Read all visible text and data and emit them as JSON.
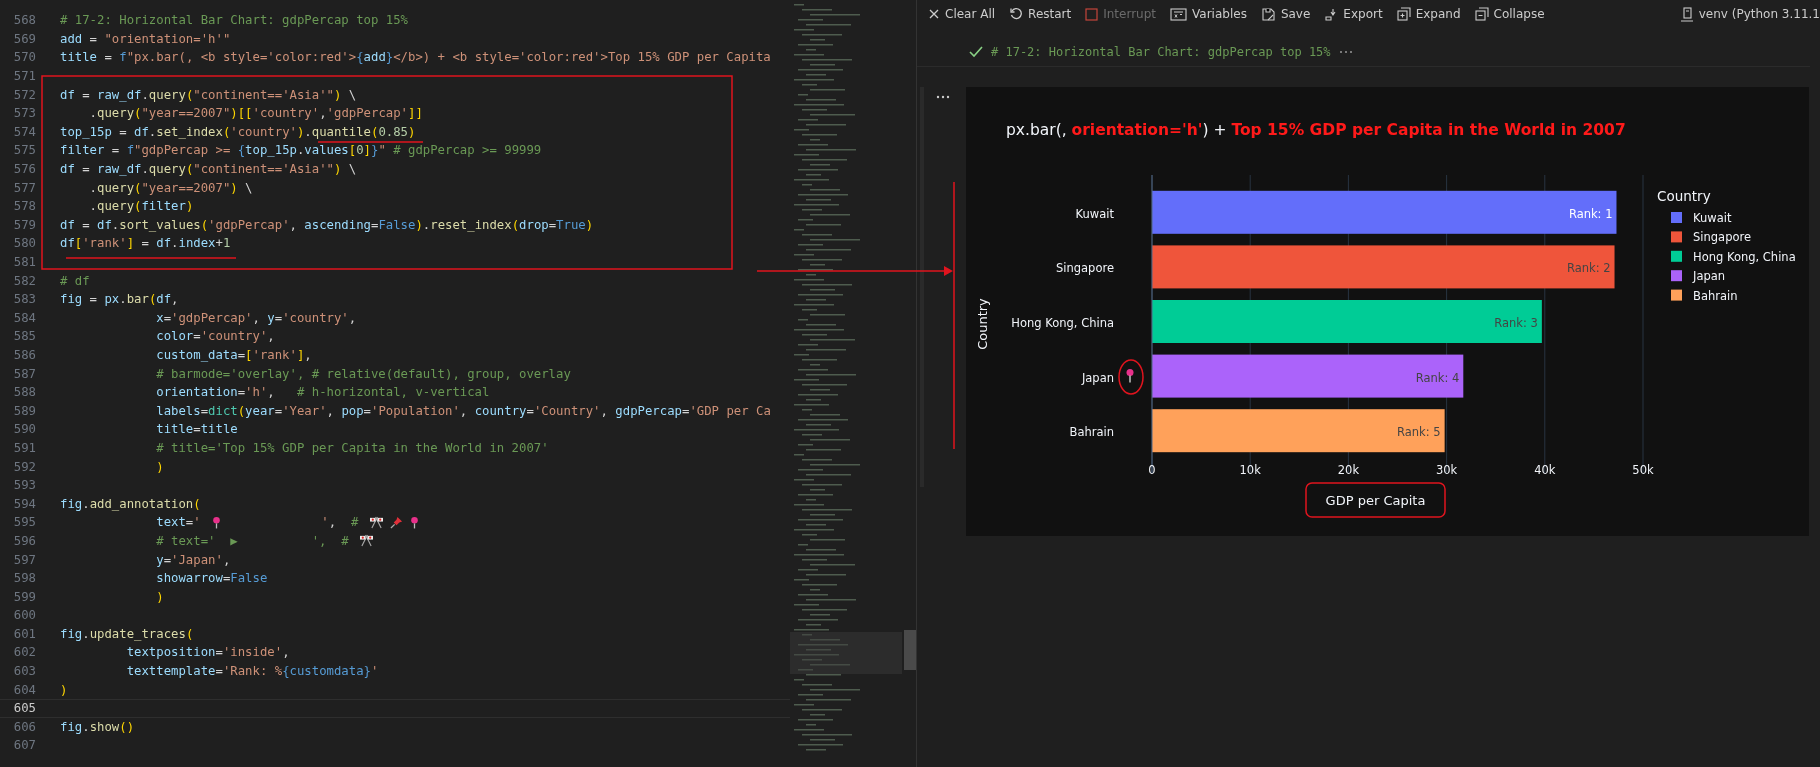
{
  "editor": {
    "lines": [
      {
        "number": "568",
        "current": false,
        "tokens": [
          {
            "kind": "comment",
            "text": "# 17-2: Horizontal Bar Chart: gdpPercap top 15%"
          }
        ]
      },
      {
        "number": "569",
        "current": false,
        "tokens": [
          {
            "kind": "variable",
            "text": "add"
          },
          {
            "kind": "plain",
            "text": " = "
          },
          {
            "kind": "string",
            "text": "\"orientation='h'\""
          }
        ]
      },
      {
        "number": "570",
        "current": false,
        "tokens": [
          {
            "kind": "variable",
            "text": "title"
          },
          {
            "kind": "plain",
            "text": " = "
          },
          {
            "kind": "keyword",
            "text": "f"
          },
          {
            "kind": "string",
            "text": "\"px.bar(, <b style='color:red'>"
          },
          {
            "kind": "keyword",
            "text": "{"
          },
          {
            "kind": "variable",
            "text": "add"
          },
          {
            "kind": "keyword",
            "text": "}"
          },
          {
            "kind": "string",
            "text": "</b>) + <b style='color:red'>Top 15% GDP per Capita"
          }
        ]
      },
      {
        "number": "571",
        "current": false
      },
      {
        "number": "572",
        "current": false,
        "tokens": [
          {
            "kind": "variable",
            "text": "df"
          },
          {
            "kind": "plain",
            "text": " = "
          },
          {
            "kind": "variable",
            "text": "raw_df"
          },
          {
            "kind": "plain",
            "text": "."
          },
          {
            "kind": "function",
            "text": "query"
          },
          {
            "kind": "bracket",
            "text": "("
          },
          {
            "kind": "string",
            "text": "\"continent=='Asia'\""
          },
          {
            "kind": "bracket",
            "text": ")"
          },
          {
            "kind": "plain",
            "text": " \\"
          }
        ]
      },
      {
        "number": "573",
        "current": false,
        "tokens": [
          {
            "kind": "plain",
            "text": "    ."
          },
          {
            "kind": "function",
            "text": "query"
          },
          {
            "kind": "bracket",
            "text": "("
          },
          {
            "kind": "string",
            "text": "\"year==2007\""
          },
          {
            "kind": "bracket",
            "text": ")"
          },
          {
            "kind": "bracket",
            "text": "[["
          },
          {
            "kind": "string",
            "text": "'country'"
          },
          {
            "kind": "plain",
            "text": ","
          },
          {
            "kind": "string",
            "text": "'gdpPercap'"
          },
          {
            "kind": "bracket",
            "text": "]]"
          }
        ]
      },
      {
        "number": "574",
        "current": false,
        "tokens": [
          {
            "kind": "variable",
            "text": "top_15p"
          },
          {
            "kind": "plain",
            "text": " = "
          },
          {
            "kind": "variable",
            "text": "df"
          },
          {
            "kind": "plain",
            "text": "."
          },
          {
            "kind": "function",
            "text": "set_index"
          },
          {
            "kind": "bracket",
            "text": "("
          },
          {
            "kind": "string",
            "text": "'country'"
          },
          {
            "kind": "bracket",
            "text": ")"
          },
          {
            "kind": "plain",
            "text": "."
          },
          {
            "kind": "function",
            "text": "quantile"
          },
          {
            "kind": "bracket",
            "text": "("
          },
          {
            "kind": "number",
            "text": "0.85"
          },
          {
            "kind": "bracket",
            "text": ")"
          }
        ]
      },
      {
        "number": "575",
        "current": false,
        "tokens": [
          {
            "kind": "variable",
            "text": "filter"
          },
          {
            "kind": "plain",
            "text": " = "
          },
          {
            "kind": "keyword",
            "text": "f"
          },
          {
            "kind": "string",
            "text": "\"gdpPercap >= "
          },
          {
            "kind": "keyword",
            "text": "{"
          },
          {
            "kind": "variable",
            "text": "top_15p"
          },
          {
            "kind": "plain",
            "text": "."
          },
          {
            "kind": "variable",
            "text": "values"
          },
          {
            "kind": "bracket",
            "text": "["
          },
          {
            "kind": "number",
            "text": "0"
          },
          {
            "kind": "bracket",
            "text": "]"
          },
          {
            "kind": "keyword",
            "text": "}"
          },
          {
            "kind": "string",
            "text": "\""
          },
          {
            "kind": "comment",
            "text": " # gdpPercap >= 99999"
          }
        ]
      },
      {
        "number": "576",
        "current": false,
        "tokens": [
          {
            "kind": "variable",
            "text": "df"
          },
          {
            "kind": "plain",
            "text": " = "
          },
          {
            "kind": "variable",
            "text": "raw_df"
          },
          {
            "kind": "plain",
            "text": "."
          },
          {
            "kind": "function",
            "text": "query"
          },
          {
            "kind": "bracket",
            "text": "("
          },
          {
            "kind": "string",
            "text": "\"continent=='Asia'\""
          },
          {
            "kind": "bracket",
            "text": ")"
          },
          {
            "kind": "plain",
            "text": " \\"
          }
        ]
      },
      {
        "number": "577",
        "current": false,
        "tokens": [
          {
            "kind": "plain",
            "text": "    ."
          },
          {
            "kind": "function",
            "text": "query"
          },
          {
            "kind": "bracket",
            "text": "("
          },
          {
            "kind": "string",
            "text": "\"year==2007\""
          },
          {
            "kind": "bracket",
            "text": ")"
          },
          {
            "kind": "plain",
            "text": " \\"
          }
        ]
      },
      {
        "number": "578",
        "current": false,
        "tokens": [
          {
            "kind": "plain",
            "text": "    ."
          },
          {
            "kind": "function",
            "text": "query"
          },
          {
            "kind": "bracket",
            "text": "("
          },
          {
            "kind": "variable",
            "text": "filter"
          },
          {
            "kind": "bracket",
            "text": ")"
          }
        ]
      },
      {
        "number": "579",
        "current": false,
        "tokens": [
          {
            "kind": "variable",
            "text": "df"
          },
          {
            "kind": "plain",
            "text": " = "
          },
          {
            "kind": "variable",
            "text": "df"
          },
          {
            "kind": "plain",
            "text": "."
          },
          {
            "kind": "function",
            "text": "sort_values"
          },
          {
            "kind": "bracket",
            "text": "("
          },
          {
            "kind": "string",
            "text": "'gdpPercap'"
          },
          {
            "kind": "plain",
            "text": ", "
          },
          {
            "kind": "variable",
            "text": "ascending"
          },
          {
            "kind": "plain",
            "text": "="
          },
          {
            "kind": "keyword",
            "text": "False"
          },
          {
            "kind": "bracket",
            "text": ")"
          },
          {
            "kind": "plain",
            "text": "."
          },
          {
            "kind": "function",
            "text": "reset_index"
          },
          {
            "kind": "bracket",
            "text": "("
          },
          {
            "kind": "variable",
            "text": "drop"
          },
          {
            "kind": "plain",
            "text": "="
          },
          {
            "kind": "keyword",
            "text": "True"
          },
          {
            "kind": "bracket",
            "text": ")"
          }
        ]
      },
      {
        "number": "580",
        "current": false,
        "tokens": [
          {
            "kind": "variable",
            "text": "df"
          },
          {
            "kind": "bracket",
            "text": "["
          },
          {
            "kind": "string",
            "text": "'rank'"
          },
          {
            "kind": "bracket",
            "text": "]"
          },
          {
            "kind": "plain",
            "text": " = "
          },
          {
            "kind": "variable",
            "text": "df"
          },
          {
            "kind": "plain",
            "text": "."
          },
          {
            "kind": "variable",
            "text": "index"
          },
          {
            "kind": "plain",
            "text": "+"
          },
          {
            "kind": "number",
            "text": "1"
          }
        ]
      },
      {
        "number": "581",
        "current": false
      },
      {
        "number": "582",
        "current": false,
        "tokens": [
          {
            "kind": "comment",
            "text": "# df"
          }
        ]
      },
      {
        "number": "583",
        "current": false,
        "tokens": [
          {
            "kind": "variable",
            "text": "fig"
          },
          {
            "kind": "plain",
            "text": " = "
          },
          {
            "kind": "variable",
            "text": "px"
          },
          {
            "kind": "plain",
            "text": "."
          },
          {
            "kind": "function",
            "text": "bar"
          },
          {
            "kind": "bracket",
            "text": "("
          },
          {
            "kind": "variable",
            "text": "df"
          },
          {
            "kind": "plain",
            "text": ","
          }
        ]
      },
      {
        "number": "584",
        "current": false,
        "tokens": [
          {
            "kind": "variable",
            "text": "             x"
          },
          {
            "kind": "plain",
            "text": "="
          },
          {
            "kind": "string",
            "text": "'gdpPercap'"
          },
          {
            "kind": "plain",
            "text": ", "
          },
          {
            "kind": "variable",
            "text": "y"
          },
          {
            "kind": "plain",
            "text": "="
          },
          {
            "kind": "string",
            "text": "'country'"
          },
          {
            "kind": "plain",
            "text": ","
          }
        ]
      },
      {
        "number": "585",
        "current": false,
        "tokens": [
          {
            "kind": "variable",
            "text": "             color"
          },
          {
            "kind": "plain",
            "text": "="
          },
          {
            "kind": "string",
            "text": "'country'"
          },
          {
            "kind": "plain",
            "text": ","
          }
        ]
      },
      {
        "number": "586",
        "current": false,
        "tokens": [
          {
            "kind": "variable",
            "text": "             custom_data"
          },
          {
            "kind": "plain",
            "text": "="
          },
          {
            "kind": "bracket",
            "text": "["
          },
          {
            "kind": "string",
            "text": "'rank'"
          },
          {
            "kind": "bracket",
            "text": "]"
          },
          {
            "kind": "plain",
            "text": ","
          }
        ]
      },
      {
        "number": "587",
        "current": false,
        "tokens": [
          {
            "kind": "comment",
            "text": "             # barmode='overlay', # relative(default), group, overlay"
          }
        ]
      },
      {
        "number": "588",
        "current": false,
        "tokens": [
          {
            "kind": "variable",
            "text": "             orientation"
          },
          {
            "kind": "plain",
            "text": "="
          },
          {
            "kind": "string",
            "text": "'h'"
          },
          {
            "kind": "plain",
            "text": ","
          },
          {
            "kind": "comment",
            "text": "   # h-horizontal, v-vertical"
          }
        ]
      },
      {
        "number": "589",
        "current": false,
        "tokens": [
          {
            "kind": "variable",
            "text": "             labels"
          },
          {
            "kind": "plain",
            "text": "="
          },
          {
            "kind": "class",
            "text": "dict"
          },
          {
            "kind": "bracket",
            "text": "("
          },
          {
            "kind": "variable",
            "text": "year"
          },
          {
            "kind": "plain",
            "text": "="
          },
          {
            "kind": "string",
            "text": "'Year'"
          },
          {
            "kind": "plain",
            "text": ", "
          },
          {
            "kind": "variable",
            "text": "pop"
          },
          {
            "kind": "plain",
            "text": "="
          },
          {
            "kind": "string",
            "text": "'Population'"
          },
          {
            "kind": "plain",
            "text": ", "
          },
          {
            "kind": "variable",
            "text": "country"
          },
          {
            "kind": "plain",
            "text": "="
          },
          {
            "kind": "string",
            "text": "'Country'"
          },
          {
            "kind": "plain",
            "text": ", "
          },
          {
            "kind": "variable",
            "text": "gdpPercap"
          },
          {
            "kind": "plain",
            "text": "="
          },
          {
            "kind": "string",
            "text": "'GDP per Ca"
          }
        ]
      },
      {
        "number": "590",
        "current": false,
        "tokens": [
          {
            "kind": "variable",
            "text": "             title"
          },
          {
            "kind": "plain",
            "text": "="
          },
          {
            "kind": "variable",
            "text": "title"
          }
        ]
      },
      {
        "number": "591",
        "current": false,
        "tokens": [
          {
            "kind": "comment",
            "text": "             # title='Top 15% GDP per Capita in the World in 2007'"
          }
        ]
      },
      {
        "number": "592",
        "current": false,
        "tokens": [
          {
            "kind": "bracket",
            "text": "             )"
          }
        ]
      },
      {
        "number": "593",
        "current": false
      },
      {
        "number": "594",
        "current": false,
        "tokens": [
          {
            "kind": "variable",
            "text": "fig"
          },
          {
            "kind": "plain",
            "text": "."
          },
          {
            "kind": "function",
            "text": "add_annotation"
          },
          {
            "kind": "bracket",
            "text": "("
          }
        ]
      },
      {
        "number": "595",
        "current": false,
        "tokens": [
          {
            "kind": "variable",
            "text": "             text"
          },
          {
            "kind": "plain",
            "text": "="
          },
          {
            "kind": "string",
            "text": "' "
          },
          {
            "kind": "pin"
          },
          {
            "kind": "string",
            "text": "             '"
          },
          {
            "kind": "plain",
            "text": ",  "
          },
          {
            "kind": "comment",
            "text": "# "
          },
          {
            "kind": "flags"
          },
          {
            "kind": "pushpin"
          },
          {
            "kind": "pin"
          }
        ]
      },
      {
        "number": "596",
        "current": false,
        "tokens": [
          {
            "kind": "comment",
            "text": "             # text='  ▶          ',  # "
          },
          {
            "kind": "flags"
          }
        ]
      },
      {
        "number": "597",
        "current": false,
        "tokens": [
          {
            "kind": "variable",
            "text": "             y"
          },
          {
            "kind": "plain",
            "text": "="
          },
          {
            "kind": "string",
            "text": "'Japan'"
          },
          {
            "kind": "plain",
            "text": ","
          }
        ]
      },
      {
        "number": "598",
        "current": false,
        "tokens": [
          {
            "kind": "variable",
            "text": "             showarrow"
          },
          {
            "kind": "plain",
            "text": "="
          },
          {
            "kind": "keyword",
            "text": "False"
          }
        ]
      },
      {
        "number": "599",
        "current": false,
        "tokens": [
          {
            "kind": "bracket",
            "text": "             )"
          }
        ]
      },
      {
        "number": "600",
        "current": false
      },
      {
        "number": "601",
        "current": false,
        "tokens": [
          {
            "kind": "variable",
            "text": "fig"
          },
          {
            "kind": "plain",
            "text": "."
          },
          {
            "kind": "function",
            "text": "update_traces"
          },
          {
            "kind": "bracket",
            "text": "("
          }
        ]
      },
      {
        "number": "602",
        "current": false,
        "tokens": [
          {
            "kind": "variable",
            "text": "         textposition"
          },
          {
            "kind": "plain",
            "text": "="
          },
          {
            "kind": "string",
            "text": "'inside'"
          },
          {
            "kind": "plain",
            "text": ","
          }
        ]
      },
      {
        "number": "603",
        "current": false,
        "tokens": [
          {
            "kind": "variable",
            "text": "         texttemplate"
          },
          {
            "kind": "plain",
            "text": "="
          },
          {
            "kind": "string",
            "text": "'Rank: %"
          },
          {
            "kind": "keyword",
            "text": "{customdata}"
          },
          {
            "kind": "string",
            "text": "'"
          }
        ]
      },
      {
        "number": "604",
        "current": false,
        "tokens": [
          {
            "kind": "bracket",
            "text": ")"
          }
        ]
      },
      {
        "number": "605",
        "current": true
      },
      {
        "number": "606",
        "current": false,
        "tokens": [
          {
            "kind": "variable",
            "text": "fig"
          },
          {
            "kind": "plain",
            "text": "."
          },
          {
            "kind": "function",
            "text": "show"
          },
          {
            "kind": "bracket",
            "text": "()"
          }
        ]
      },
      {
        "number": "607",
        "current": false
      }
    ]
  },
  "interactive": {
    "toolbar": [
      {
        "label": "Clear All",
        "disabled": false
      },
      {
        "label": "Restart",
        "disabled": false
      },
      {
        "label": "Interrupt",
        "disabled": true
      },
      {
        "label": "Variables",
        "disabled": false
      },
      {
        "label": "Save",
        "disabled": false
      },
      {
        "label": "Export",
        "disabled": false
      },
      {
        "label": "Expand",
        "disabled": false
      },
      {
        "label": "Collapse",
        "disabled": false
      }
    ],
    "kernel": "venv (Python 3.11.1",
    "cell": {
      "code": "# 17-2: Horizontal Bar Chart: gdpPercap top 15%",
      "succeeded": true
    },
    "chart_data": {
      "type": "bar",
      "orientation": "h",
      "title": "px.bar(, **orientation='h'**) + **Top 15% GDP per Capita in the World in 2007**",
      "xlabel": "GDP per Capita",
      "ylabel": "Country",
      "legend": {
        "title": "Country"
      },
      "grid": true,
      "categories": [
        "Kuwait",
        "Singapore",
        "Hong Kong, China",
        "Japan",
        "Bahrain"
      ],
      "series": [
        {
          "name": "Kuwait",
          "color": "#636efa",
          "values": [
            47300,
            null,
            null,
            null,
            null
          ]
        },
        {
          "name": "Singapore",
          "color": "#ef553b",
          "values": [
            null,
            47100,
            null,
            null,
            null
          ]
        },
        {
          "name": "Hong Kong, China",
          "color": "#00cc96",
          "values": [
            null,
            null,
            39700,
            null,
            null
          ]
        },
        {
          "name": "Japan",
          "color": "#ab63fa",
          "values": [
            null,
            null,
            null,
            31700,
            null
          ]
        },
        {
          "name": "Bahrain",
          "color": "#ffa15a",
          "values": [
            null,
            null,
            null,
            null,
            29800
          ]
        }
      ],
      "xlim": [
        0,
        50000
      ],
      "xticks": [
        {
          "value": 0,
          "label": "0"
        },
        {
          "value": 10000,
          "label": "10k"
        },
        {
          "value": 20000,
          "label": "20k"
        },
        {
          "value": 30000,
          "label": "30k"
        },
        {
          "value": 40000,
          "label": "40k"
        },
        {
          "value": 50000,
          "label": "50k"
        }
      ],
      "value_labels": [
        "Rank: 1",
        "Rank: 2",
        "Rank: 3",
        "Rank: 4",
        "Rank: 5"
      ],
      "annotations": [
        {
          "y": "Japan"
        }
      ]
    }
  }
}
